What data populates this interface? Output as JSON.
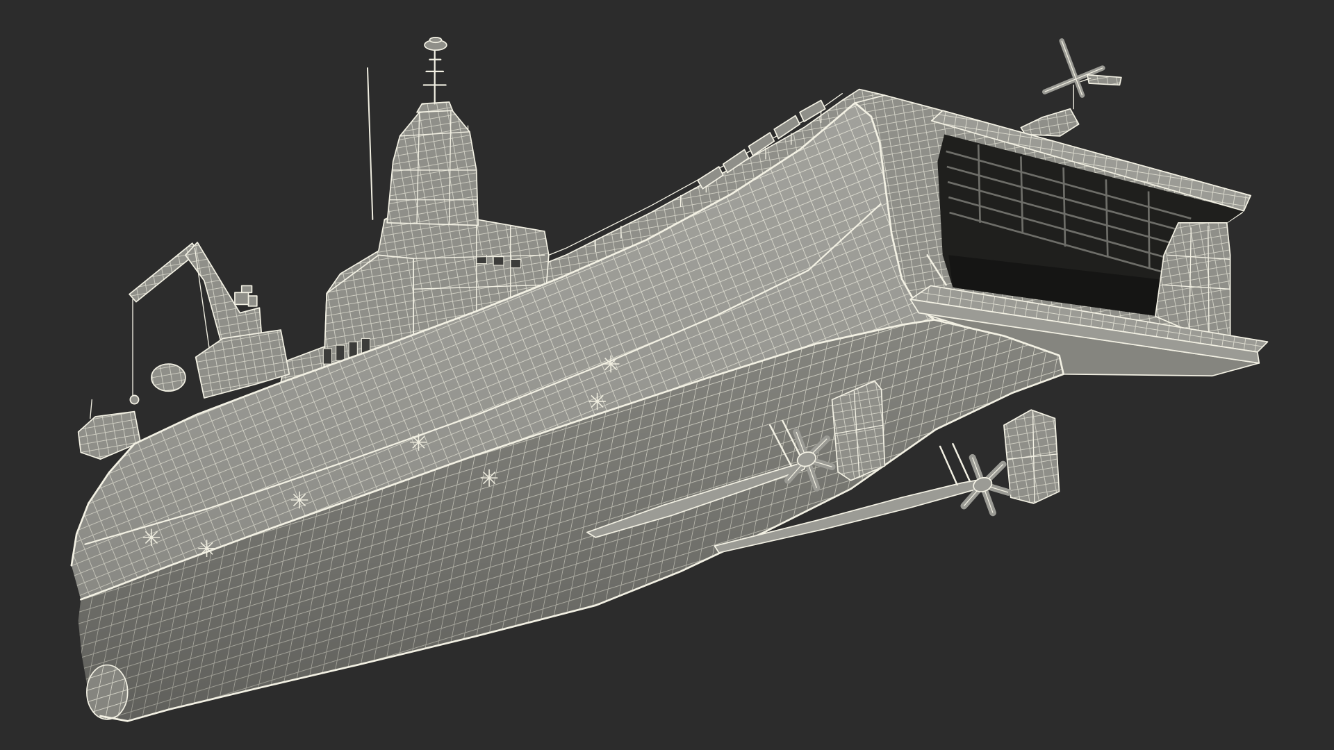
{
  "scene": {
    "background_color": "#2c2c2c",
    "hull_color": "#9b9b95",
    "hull_shadow_color": "#85857f",
    "superstructure_color": "#8f8f89",
    "wire_color": "#f3f1e4",
    "hangar_color": "#1f1f1d"
  }
}
